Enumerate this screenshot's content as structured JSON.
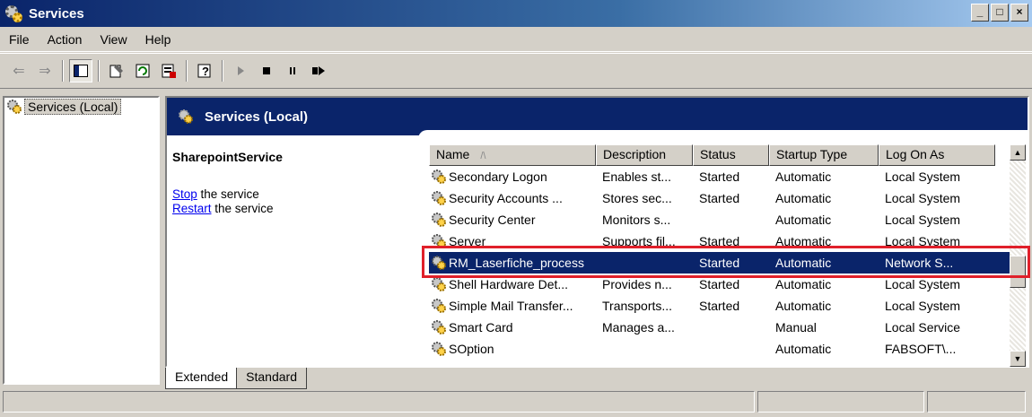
{
  "window": {
    "title": "Services"
  },
  "menu": {
    "file": "File",
    "action": "Action",
    "view": "View",
    "help": "Help"
  },
  "toolbar": {
    "buttons": [
      "back-icon",
      "forward-icon",
      "show-hide-tree-icon",
      "properties-icon",
      "refresh-icon",
      "export-list-icon",
      "help-icon",
      "start-service-icon",
      "stop-service-icon",
      "pause-service-icon",
      "restart-service-icon"
    ]
  },
  "tree": {
    "root_label": "Services (Local)"
  },
  "banner": {
    "title": "Services (Local)"
  },
  "details": {
    "service_name": "SharepointService",
    "stop_link": "Stop",
    "stop_suffix": " the service",
    "restart_link": "Restart",
    "restart_suffix": " the service"
  },
  "columns": {
    "name": "Name",
    "sort_indicator": "/\\",
    "description": "Description",
    "status": "Status",
    "startup_type": "Startup Type",
    "log_on_as": "Log On As"
  },
  "rows": [
    {
      "name": "Secondary Logon",
      "description": "Enables st...",
      "status": "Started",
      "startup": "Automatic",
      "logon": "Local System"
    },
    {
      "name": "Security Accounts ...",
      "description": "Stores sec...",
      "status": "Started",
      "startup": "Automatic",
      "logon": "Local System"
    },
    {
      "name": "Security Center",
      "description": "Monitors s...",
      "status": "",
      "startup": "Automatic",
      "logon": "Local System"
    },
    {
      "name": "Server",
      "description": "Supports fil...",
      "status": "Started",
      "startup": "Automatic",
      "logon": "Local System"
    },
    {
      "name": "RM_Laserfiche_process",
      "description": "",
      "status": "Started",
      "startup": "Automatic",
      "logon": "Network S..."
    },
    {
      "name": "Shell Hardware Det...",
      "description": "Provides n...",
      "status": "Started",
      "startup": "Automatic",
      "logon": "Local System"
    },
    {
      "name": "Simple Mail Transfer...",
      "description": "Transports...",
      "status": "Started",
      "startup": "Automatic",
      "logon": "Local System"
    },
    {
      "name": "Smart Card",
      "description": "Manages a...",
      "status": "",
      "startup": "Manual",
      "logon": "Local Service"
    },
    {
      "name": "SOption",
      "description": "",
      "status": "",
      "startup": "Automatic",
      "logon": "FABSOFT\\..."
    }
  ],
  "tabs": {
    "extended": "Extended",
    "standard": "Standard"
  },
  "colors": {
    "highlight_box": "#e0202a",
    "selection": "#0a246a",
    "banner": "#0a246a"
  }
}
